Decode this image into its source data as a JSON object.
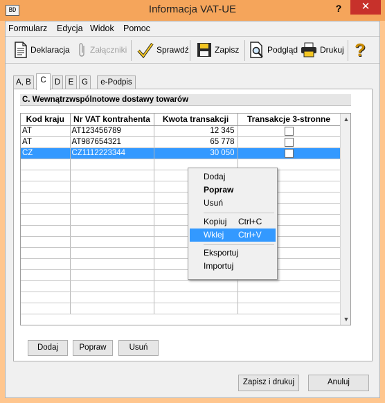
{
  "window": {
    "title": "Informacja VAT-UE",
    "app_icon_text": "BD",
    "help_glyph": "?",
    "close_glyph": "✕"
  },
  "menu": {
    "items": [
      "Formularz",
      "Edycja",
      "Widok",
      "Pomoc"
    ]
  },
  "toolbar": {
    "deklaracja": "Deklaracja",
    "zalaczniki": "Załączniki",
    "sprawdz": "Sprawdź",
    "zapisz": "Zapisz",
    "podglad": "Podgląd",
    "drukuj": "Drukuj",
    "help_glyph": "?"
  },
  "tabs": [
    {
      "label": "A, B"
    },
    {
      "label": "C"
    },
    {
      "label": "D"
    },
    {
      "label": "E"
    },
    {
      "label": "G"
    },
    {
      "label": "e-Podpis"
    }
  ],
  "active_tab": "C",
  "section": {
    "title": "C. Wewnątrzwspólnotowe dostawy towarów"
  },
  "table": {
    "headers": [
      "Kod kraju",
      "Nr VAT kontrahenta",
      "Kwota transakcji",
      "Transakcje 3-stronne"
    ],
    "rows": [
      {
        "kod": "AT",
        "nr_vat": "AT123456789",
        "kwota": "12 345",
        "trojstronne": false
      },
      {
        "kod": "AT",
        "nr_vat": "AT987654321",
        "kwota": "65 778",
        "trojstronne": false
      },
      {
        "kod": "CZ",
        "nr_vat": "CZ1112223344",
        "kwota": "30 050",
        "trojstronne": false
      }
    ],
    "selected_row": 2
  },
  "row_buttons": {
    "dodaj": "Dodaj",
    "popraw": "Popraw",
    "usun": "Usuń"
  },
  "context_menu": {
    "dodaj": "Dodaj",
    "popraw": "Popraw",
    "usun": "Usuń",
    "kopiuj": "Kopiuj",
    "kopiuj_shortcut": "Ctrl+C",
    "wklej": "Wklej",
    "wklej_shortcut": "Ctrl+V",
    "eksportuj": "Eksportuj",
    "importuj": "Importuj",
    "highlighted": "Wklej"
  },
  "footer": {
    "zapisz_drukuj": "Zapisz i drukuj",
    "anuluj": "Anuluj"
  },
  "colors": {
    "titlebar": "#f5a55b",
    "frame": "#ffc68e",
    "close": "#c7312b",
    "selection": "#3399ff"
  }
}
